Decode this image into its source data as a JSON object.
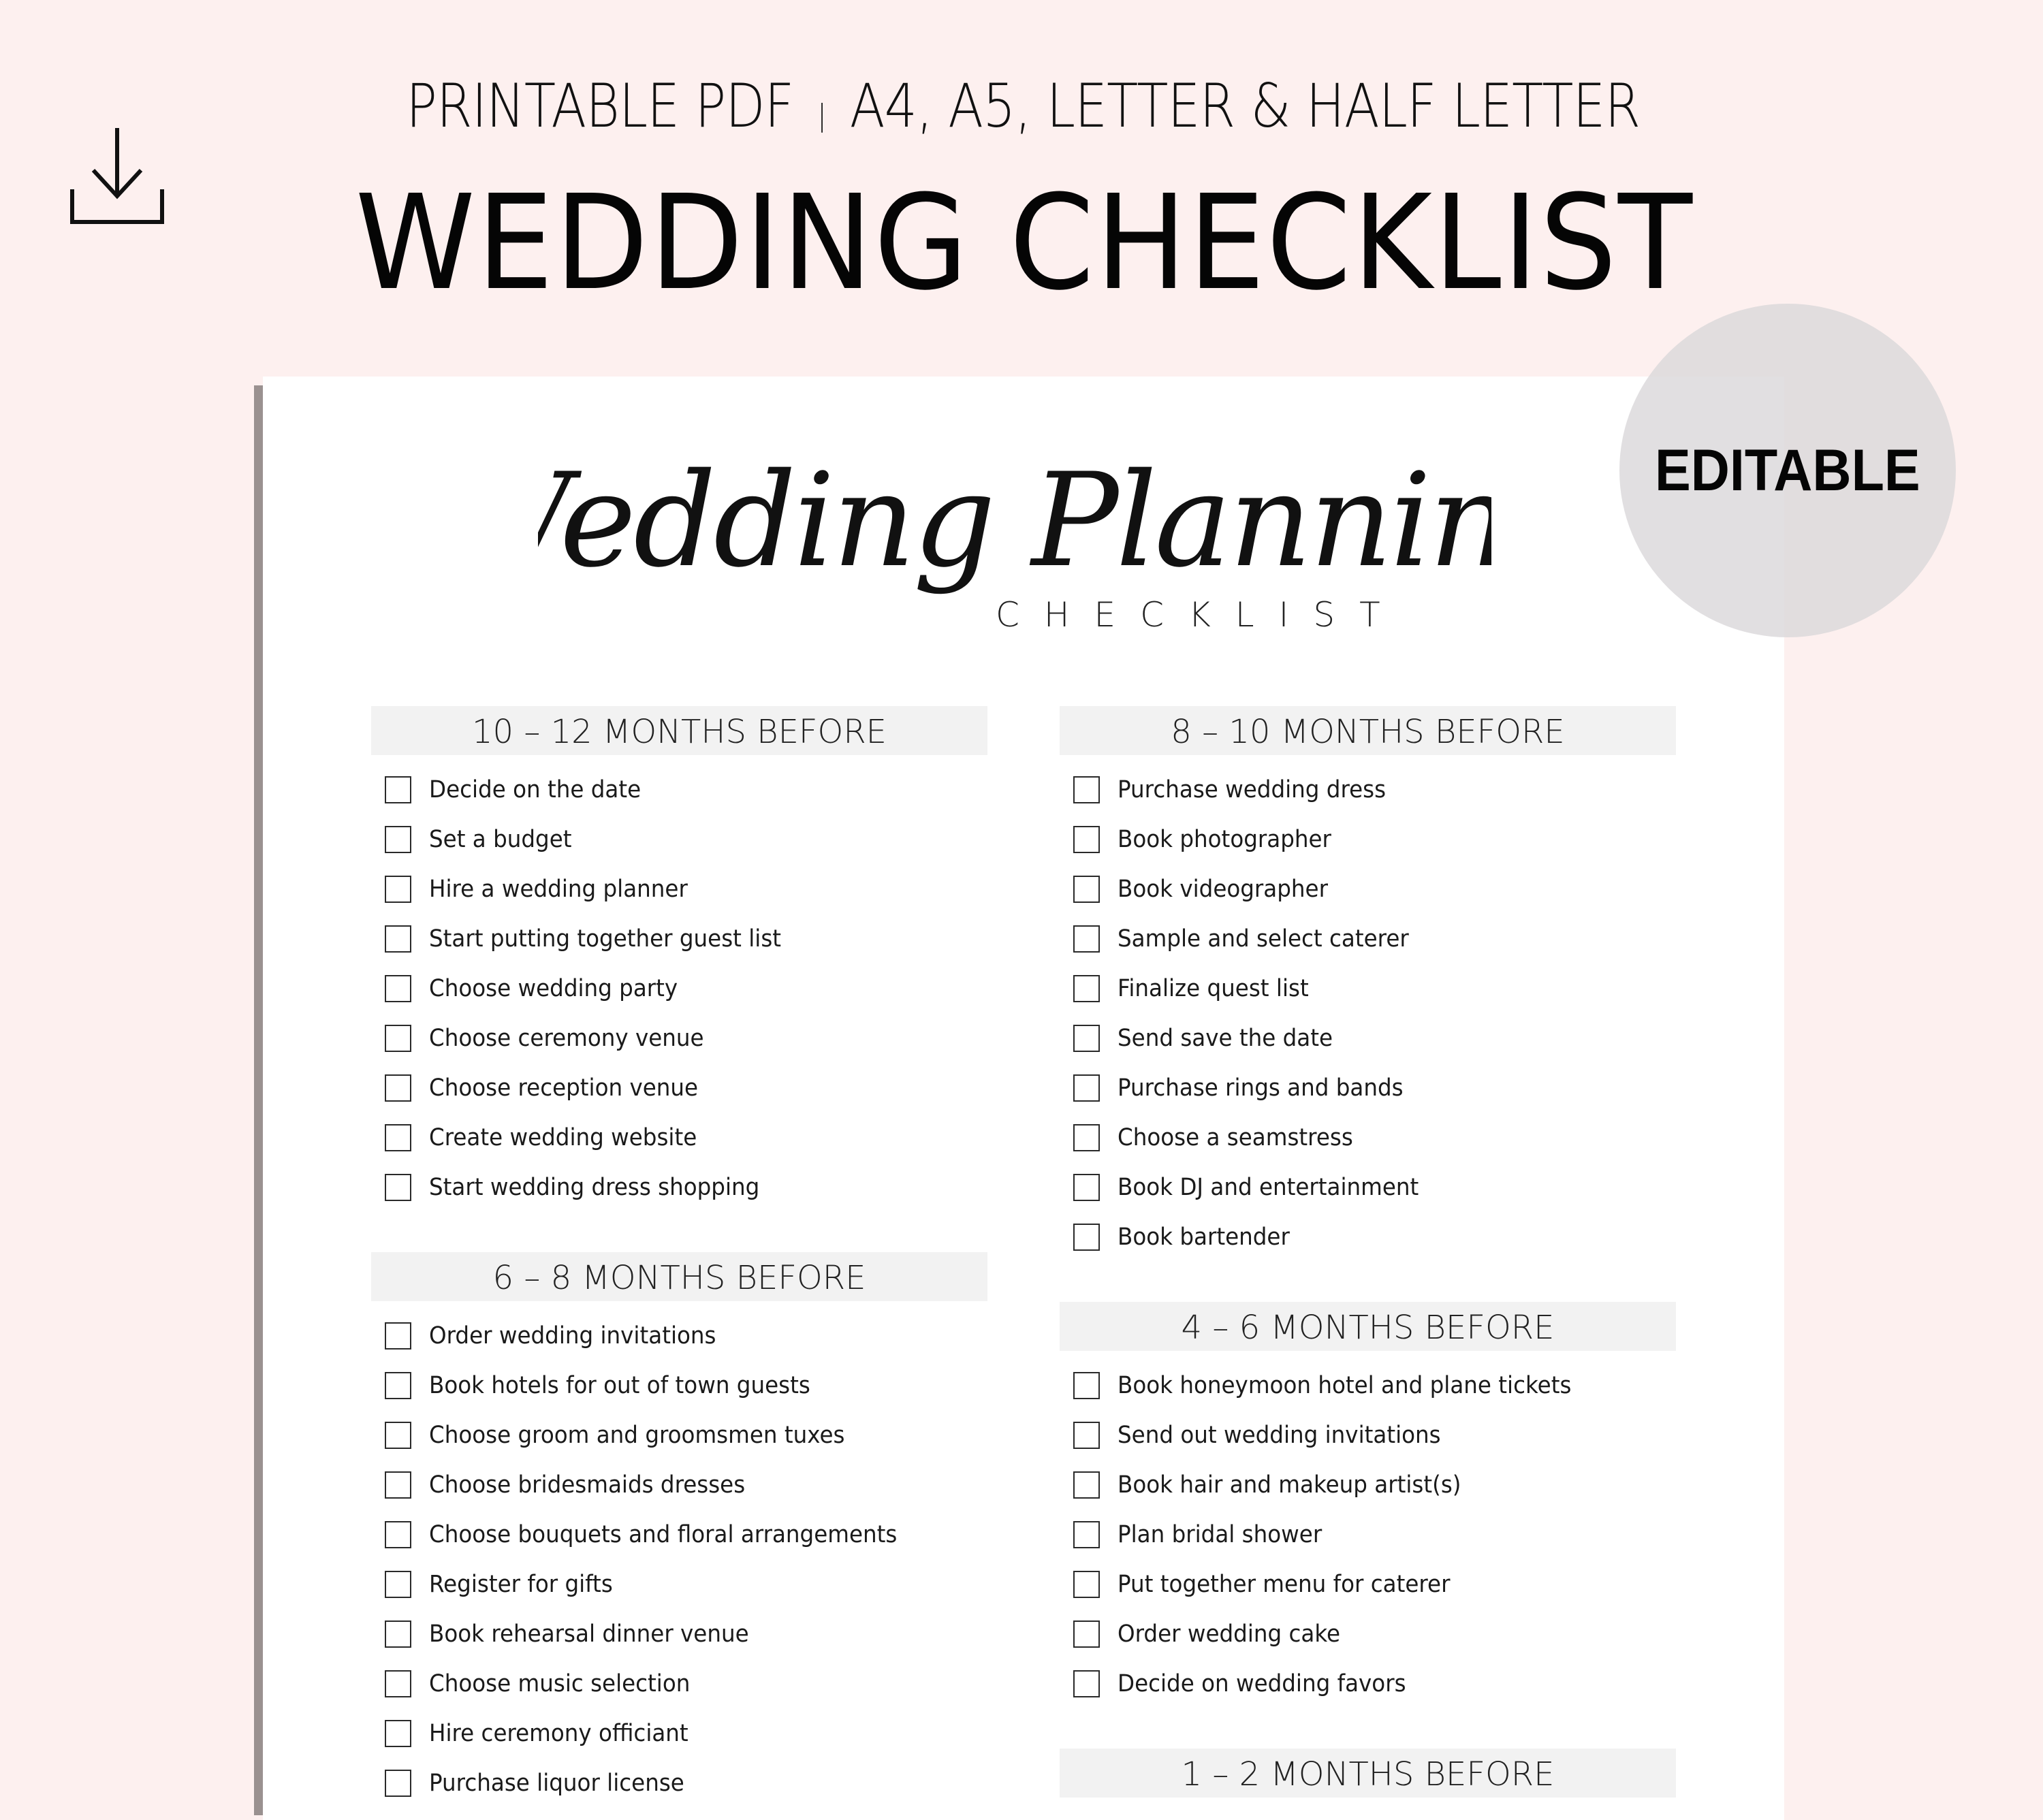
{
  "banner": {
    "subtitle_left": "PRINTABLE PDF",
    "subtitle_separator": "|",
    "subtitle_right": "A4, A5, LETTER & HALF LETTER",
    "title": "WEDDING CHECKLIST",
    "download_icon": "download-icon"
  },
  "badge": {
    "label": "EDITABLE"
  },
  "colors": {
    "background": "#fdf0ef",
    "page": "#ffffff",
    "section_header_bg": "#f2f2f2",
    "badge_bg": "#dad8da",
    "text": "#111111"
  },
  "document": {
    "script_title": "Wedding Planning",
    "script_subtitle": "CHECKLIST",
    "sections": [
      {
        "title": "10 – 12 MONTHS BEFORE",
        "items": [
          {
            "label": "Decide on the date",
            "checked": false
          },
          {
            "label": "Set a budget",
            "checked": false
          },
          {
            "label": "Hire a wedding planner",
            "checked": false
          },
          {
            "label": "Start putting together guest list",
            "checked": false
          },
          {
            "label": "Choose wedding party",
            "checked": false
          },
          {
            "label": "Choose ceremony venue",
            "checked": false
          },
          {
            "label": "Choose reception venue",
            "checked": false
          },
          {
            "label": "Create wedding website",
            "checked": false
          },
          {
            "label": "Start wedding dress shopping",
            "checked": false
          }
        ]
      },
      {
        "title": "8 – 10 MONTHS BEFORE",
        "items": [
          {
            "label": "Purchase wedding dress",
            "checked": false
          },
          {
            "label": "Book photographer",
            "checked": false
          },
          {
            "label": "Book videographer",
            "checked": false
          },
          {
            "label": "Sample and select caterer",
            "checked": false
          },
          {
            "label": "Finalize quest list",
            "checked": false
          },
          {
            "label": "Send save the date",
            "checked": false
          },
          {
            "label": "Purchase rings and bands",
            "checked": false
          },
          {
            "label": "Choose a seamstress",
            "checked": false
          },
          {
            "label": "Book DJ and entertainment",
            "checked": false
          },
          {
            "label": "Book bartender",
            "checked": false
          }
        ]
      },
      {
        "title": "6 – 8 MONTHS BEFORE",
        "items": [
          {
            "label": "Order wedding invitations",
            "checked": false
          },
          {
            "label": "Book hotels for out of town guests",
            "checked": false
          },
          {
            "label": "Choose groom and groomsmen tuxes",
            "checked": false
          },
          {
            "label": "Choose bridesmaids dresses",
            "checked": false
          },
          {
            "label": "Choose bouquets and floral arrangements",
            "checked": false
          },
          {
            "label": "Register for gifts",
            "checked": false
          },
          {
            "label": "Book rehearsal dinner venue",
            "checked": false
          },
          {
            "label": "Choose music selection",
            "checked": false
          },
          {
            "label": "Hire ceremony officiant",
            "checked": false
          },
          {
            "label": "Purchase liquor license",
            "checked": false
          }
        ]
      },
      {
        "title": "4 – 6 MONTHS BEFORE",
        "items": [
          {
            "label": "Book honeymoon hotel and plane tickets",
            "checked": false
          },
          {
            "label": "Send out wedding invitations",
            "checked": false
          },
          {
            "label": "Book hair and makeup artist(s)",
            "checked": false
          },
          {
            "label": "Plan bridal shower",
            "checked": false
          },
          {
            "label": "Put together menu for caterer",
            "checked": false
          },
          {
            "label": "Order wedding cake",
            "checked": false
          },
          {
            "label": "Decide on wedding favors",
            "checked": false
          }
        ]
      },
      {
        "title": "1 – 2 MONTHS BEFORE",
        "items": []
      }
    ]
  }
}
